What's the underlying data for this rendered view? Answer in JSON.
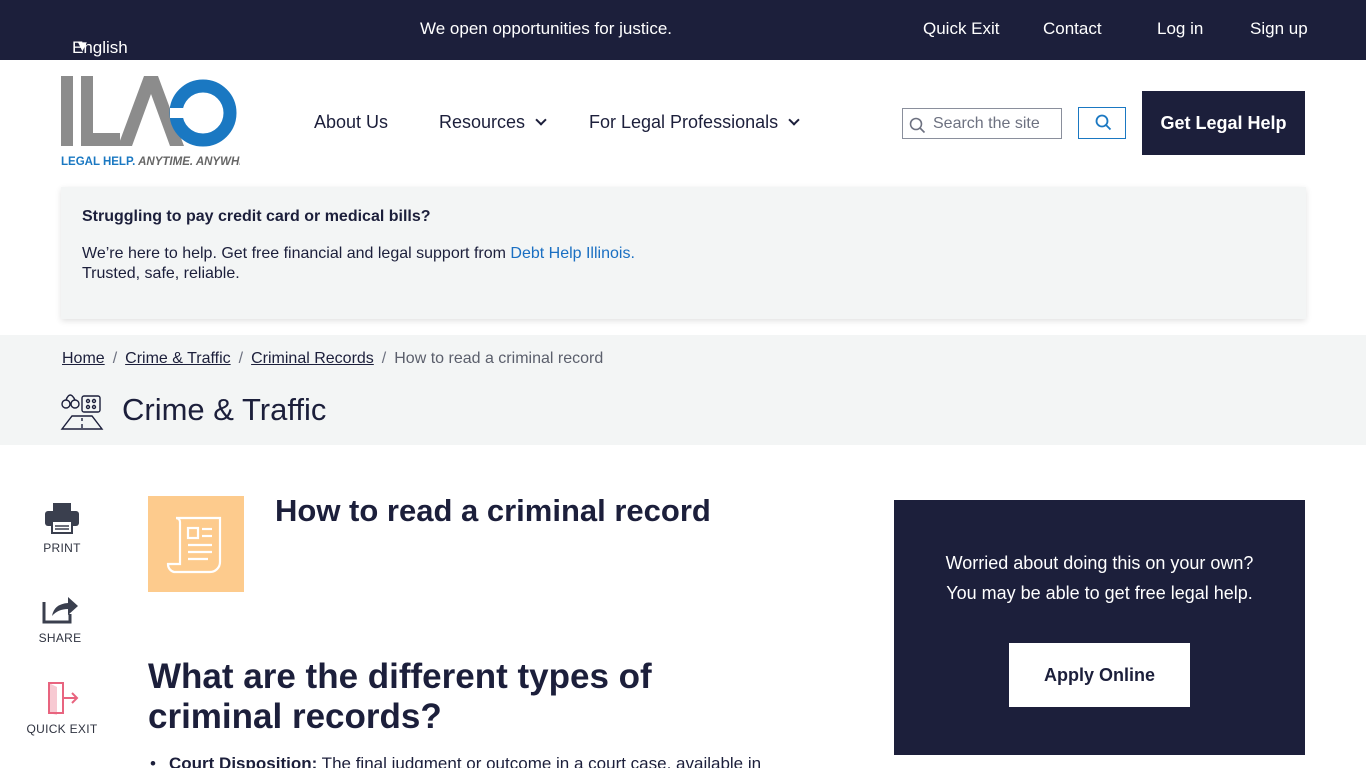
{
  "topbar": {
    "language": "English",
    "tagline": "We open opportunities for justice.",
    "links": [
      "Quick Exit",
      "Contact",
      "Log in",
      "Sign up"
    ]
  },
  "logo": {
    "text": "ILAO",
    "slogan_part1": "LEGAL HELP.",
    "slogan_part2": " ANYTIME. ANYWHERE."
  },
  "nav": {
    "about": "About Us",
    "resources": "Resources",
    "professionals": "For Legal Professionals"
  },
  "search": {
    "placeholder": "Search the site"
  },
  "header": {
    "cta": "Get Legal Help"
  },
  "alert": {
    "title": "Struggling to pay credit card or medical bills?",
    "body_prefix": "We’re here to help. Get free financial and legal support from ",
    "link": "Debt Help Illinois.",
    "body_line2": "Trusted, safe, reliable."
  },
  "breadcrumb": {
    "home": "Home",
    "crime": "Crime & Traffic",
    "records": "Criminal Records",
    "current": "How to read a criminal record"
  },
  "category": {
    "title": "Crime & Traffic"
  },
  "tools": {
    "print": "PRINT",
    "share": "SHARE",
    "quick_exit": "QUICK EXIT"
  },
  "article": {
    "title": "How to read a criminal record",
    "heading": "What are the different types of criminal records?",
    "item1_term": "Court Disposition:",
    "item1_text": " The final judgment or outcome in a court case, available in"
  },
  "helpbox": {
    "line1": "Worried about doing this on your own?",
    "line2": "You may be able to get free legal help.",
    "button": "Apply Online"
  },
  "colors": {
    "navy": "#1c1f3b",
    "brand_blue": "#1a78c2",
    "article_icon_bg": "#fdcb8d",
    "quick_exit_pink": "#e8647f"
  }
}
